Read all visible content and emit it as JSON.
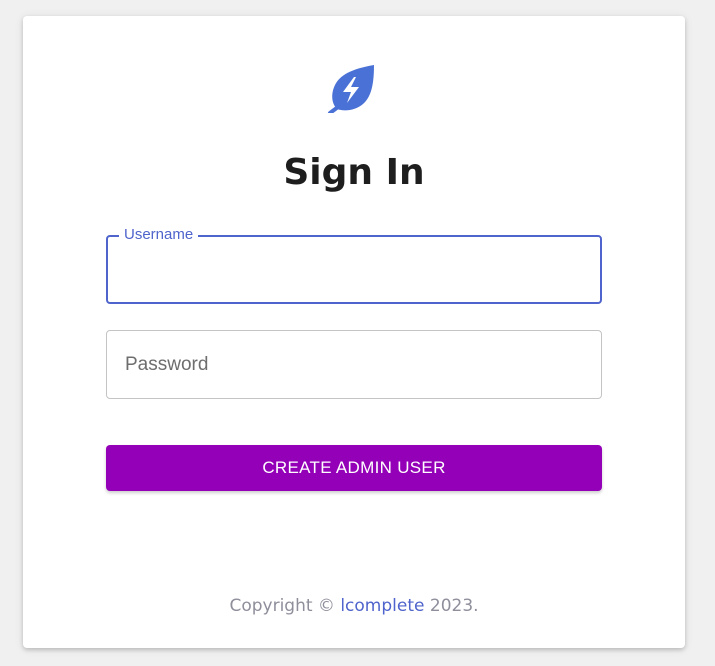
{
  "logo": {
    "icon": "leaf-lightning-icon",
    "color": "#4a72d6"
  },
  "title": "Sign In",
  "form": {
    "username": {
      "label": "Username",
      "value": ""
    },
    "password": {
      "placeholder": "Password",
      "value": ""
    },
    "submit_label": "CREATE ADMIN USER"
  },
  "footer": {
    "prefix": "Copyright © ",
    "link_text": "lcomplete",
    "suffix": " 2023."
  },
  "colors": {
    "accent": "#4f64cc",
    "button": "#9400b8",
    "brand": "#4a72d6"
  }
}
